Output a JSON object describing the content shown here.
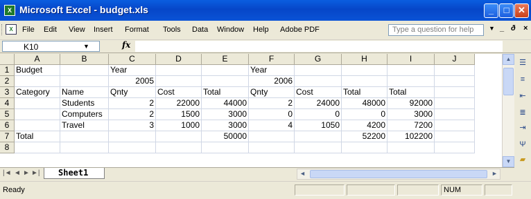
{
  "window": {
    "title": "Microsoft Excel - budget.xls",
    "app_icon": "excel-icon",
    "min": "_",
    "max": "□",
    "close": "✕"
  },
  "menu": {
    "items": [
      "File",
      "Edit",
      "View",
      "Insert",
      "Format",
      "Tools",
      "Data",
      "Window",
      "Help",
      "Adobe PDF"
    ],
    "help_placeholder": "Type a question for help",
    "doc_min": "_",
    "doc_restore": "ð",
    "doc_close": "×"
  },
  "formula_bar": {
    "name_box": "K10",
    "fx": "fx",
    "formula": ""
  },
  "grid": {
    "columns": [
      "A",
      "B",
      "C",
      "D",
      "E",
      "F",
      "G",
      "H",
      "I",
      "J"
    ],
    "rows": [
      "1",
      "2",
      "3",
      "4",
      "5",
      "6",
      "7",
      "8"
    ],
    "cells": [
      [
        "Budget",
        "",
        "Year",
        "",
        "",
        "Year",
        "",
        "",
        "",
        ""
      ],
      [
        "",
        "",
        "2005",
        "",
        "",
        "2006",
        "",
        "",
        "",
        ""
      ],
      [
        "Category",
        "Name",
        "Qnty",
        "Cost",
        "Total",
        "Qnty",
        "Cost",
        "Total",
        "Total",
        ""
      ],
      [
        "",
        "Students",
        "2",
        "22000",
        "44000",
        "2",
        "24000",
        "48000",
        "92000",
        ""
      ],
      [
        "",
        "Computers",
        "2",
        "1500",
        "3000",
        "0",
        "0",
        "0",
        "3000",
        ""
      ],
      [
        "",
        "Travel",
        "3",
        "1000",
        "3000",
        "4",
        "1050",
        "4200",
        "7200",
        ""
      ],
      [
        "Total",
        "",
        "",
        "",
        "50000",
        "",
        "",
        "52200",
        "102200",
        ""
      ],
      [
        "",
        "",
        "",
        "",
        "",
        "",
        "",
        "",
        "",
        ""
      ]
    ]
  },
  "sheet_tabs": {
    "nav": [
      "|◄",
      "◄",
      "►",
      "►|"
    ],
    "active": "Sheet1"
  },
  "status": {
    "ready": "Ready",
    "num": "NUM"
  },
  "colors": {
    "title_bar": "#0a5ee0",
    "close_button": "#c9401a",
    "excel_green": "#1f7a2a"
  }
}
